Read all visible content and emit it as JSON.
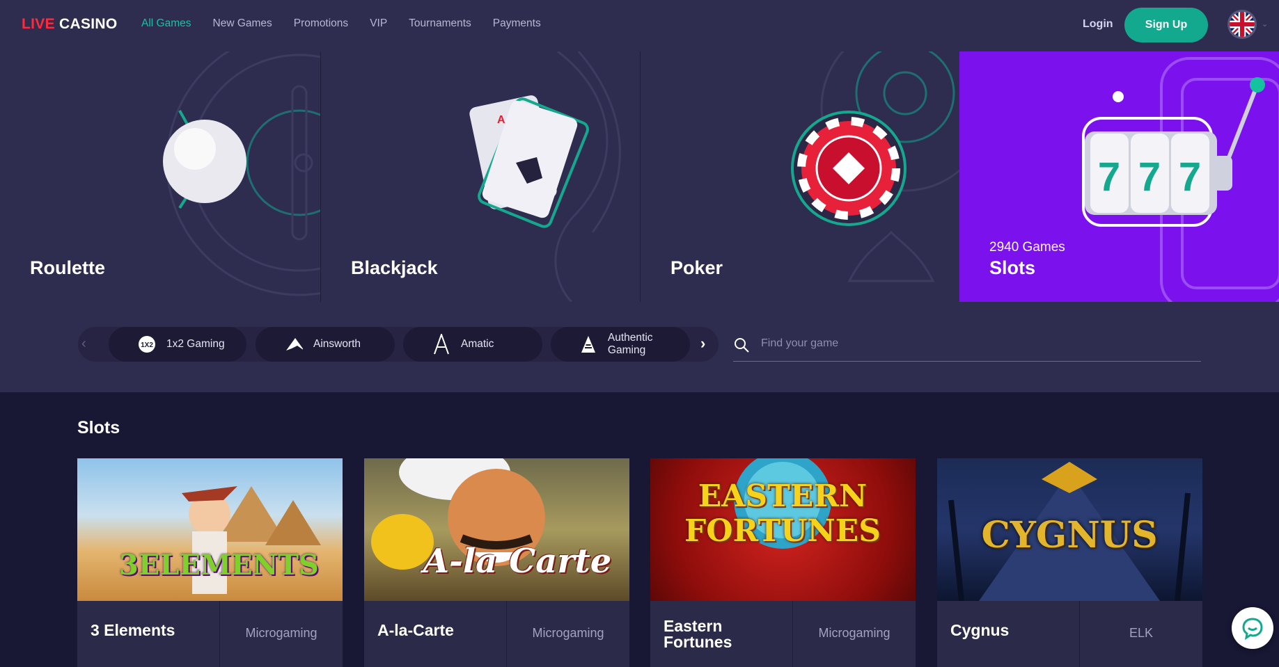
{
  "header": {
    "logo_live": "LIVE",
    "logo_casino": "CASINO",
    "nav": [
      "All Games",
      "New Games",
      "Promotions",
      "VIP",
      "Tournaments",
      "Payments"
    ],
    "login": "Login",
    "signup": "Sign Up"
  },
  "categories": [
    {
      "label": "Roulette"
    },
    {
      "label": "Blackjack"
    },
    {
      "label": "Poker"
    },
    {
      "label": "Slots",
      "count": "2940 Games"
    }
  ],
  "providers": [
    "1x2 Gaming",
    "Ainsworth",
    "Amatic",
    "Authentic Gaming"
  ],
  "search": {
    "placeholder": "Find your game"
  },
  "section": {
    "title": "Slots"
  },
  "games": [
    {
      "name": "3 Elements",
      "provider": "Microgaming",
      "art": "3ELEMENTS"
    },
    {
      "name": "A-la-Carte",
      "provider": "Microgaming",
      "art": "A-la Carte"
    },
    {
      "name": "Eastern Fortunes",
      "provider": "Microgaming",
      "art": "EASTERN FORTUNES"
    },
    {
      "name": "Cygnus",
      "provider": "ELK",
      "art": "CYGNUS"
    }
  ],
  "colors": {
    "accent": "#15c2a3",
    "signup": "#12a98e",
    "slots_bg": "#7b12ee",
    "brand_red": "#ff2a3d"
  }
}
